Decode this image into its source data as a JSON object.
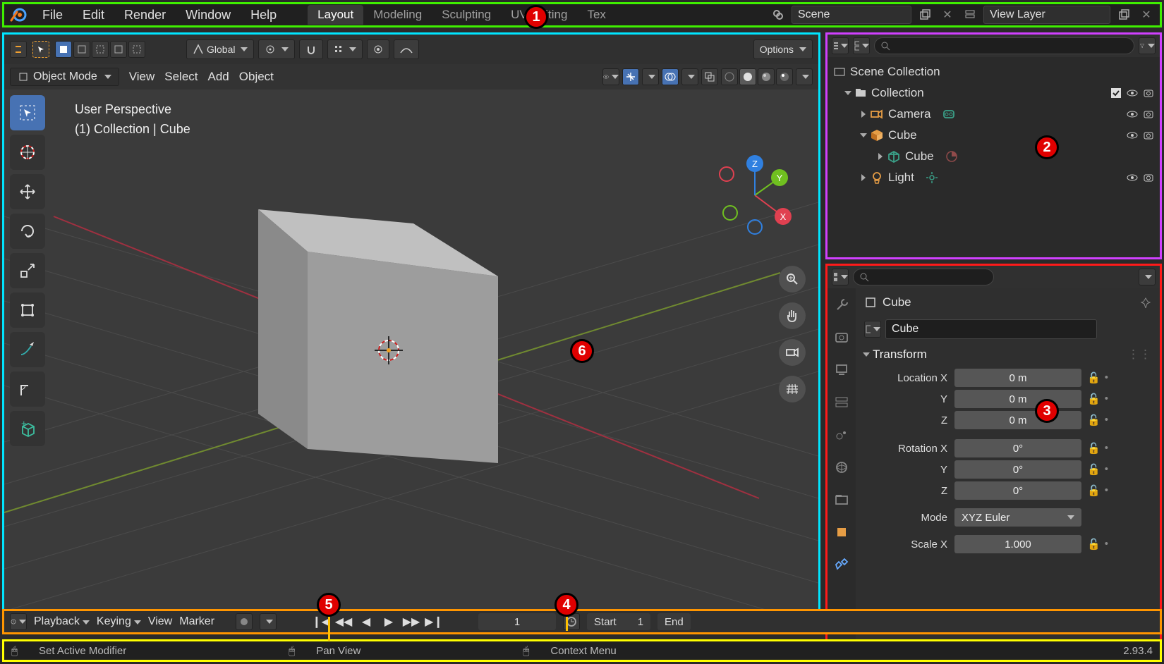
{
  "topbar": {
    "menus": [
      "File",
      "Edit",
      "Render",
      "Window",
      "Help"
    ],
    "workspaces": [
      "Layout",
      "Modeling",
      "Sculpting",
      "UV Editing",
      "Tex"
    ],
    "active_workspace": "Layout",
    "scene_field": "Scene",
    "layer_field": "View Layer"
  },
  "viewport": {
    "mode": "Object Mode",
    "menus": [
      "View",
      "Select",
      "Add",
      "Object"
    ],
    "orientation": "Global",
    "options": "Options",
    "overlay_line1": "User Perspective",
    "overlay_line2": "(1) Collection | Cube"
  },
  "outliner": {
    "root": "Scene Collection",
    "collection": "Collection",
    "items": [
      {
        "name": "Camera",
        "icon": "camera"
      },
      {
        "name": "Cube",
        "icon": "mesh",
        "child": "Cube"
      },
      {
        "name": "Light",
        "icon": "light"
      }
    ]
  },
  "props": {
    "obj_name": "Cube",
    "datablock": "Cube",
    "section": "Transform",
    "loc": {
      "x_label": "Location X",
      "y_label": "Y",
      "z_label": "Z",
      "x": "0 m",
      "y": "0 m",
      "z": "0 m"
    },
    "rot": {
      "x_label": "Rotation X",
      "y_label": "Y",
      "z_label": "Z",
      "x": "0°",
      "y": "0°",
      "z": "0°"
    },
    "mode_label": "Mode",
    "mode_val": "XYZ Euler",
    "scale": {
      "x_label": "Scale X",
      "x": "1.000"
    }
  },
  "timeline": {
    "menus": [
      "Playback",
      "Keying",
      "View",
      "Marker"
    ],
    "frame": "1",
    "start_label": "Start",
    "start_val": "1",
    "end_label": "End"
  },
  "status": {
    "items": [
      "Set Active Modifier",
      "Pan View",
      "Context Menu"
    ],
    "version": "2.93.4"
  }
}
